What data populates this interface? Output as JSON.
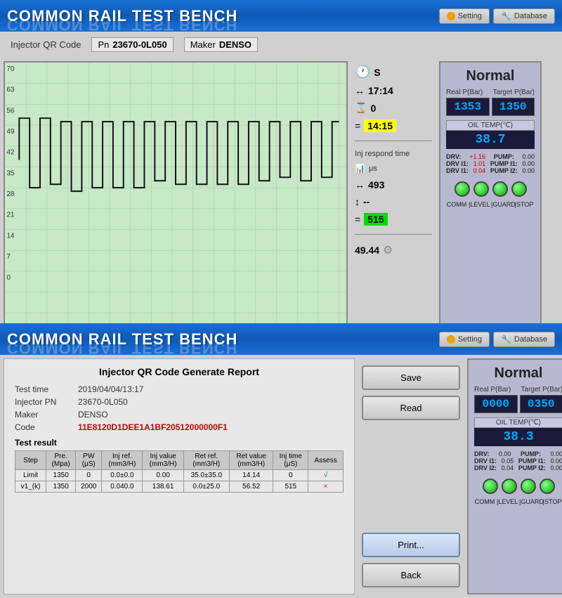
{
  "app": {
    "title": "COMMON RAIL TEST BENCH",
    "header_buttons": [
      {
        "label": "Setting",
        "icon": "gear"
      },
      {
        "label": "Database",
        "icon": "db"
      }
    ]
  },
  "top_section": {
    "injector": {
      "label": "Injector QR Code",
      "pn_label": "Pn",
      "pn_value": "23670-0L050",
      "maker_label": "Maker",
      "maker_value": "DENSO"
    },
    "info_panel": {
      "unit_s": "S",
      "time1": "17:14",
      "time2": "0",
      "time3_yellow": "14:15",
      "inj_respond_label": "Inj respond time",
      "unit_us": "μs",
      "val1": "493",
      "val2": "--",
      "val3_green": "515",
      "val4": "49.44"
    },
    "status": {
      "normal": "Normal",
      "real_p_label": "Real P(Bar)",
      "target_p_label": "Target P(Bar)",
      "real_p_value": "1353",
      "target_p_value": "1350",
      "oil_temp_label": "OIL TEMP(℃)",
      "oil_temp_value": "38.7",
      "drv": "+1.16",
      "drv1": "1.01",
      "drv2": "0.04",
      "pump": "0.00",
      "pump1": "0.00",
      "pump2": "0.00",
      "indicators": [
        "COMM",
        "LEVEL",
        "GUARD",
        "STOP"
      ]
    }
  },
  "bottom_section": {
    "report": {
      "title": "Injector QR Code Generate Report",
      "fields": [
        {
          "label": "Test time",
          "value": "2019/04/04/13:17",
          "color": "normal"
        },
        {
          "label": "Injector PN",
          "value": "23670-0L050",
          "color": "normal"
        },
        {
          "label": "Maker",
          "value": "DENSO",
          "color": "normal"
        },
        {
          "label": "Code",
          "value": "11E8120D1DEE1A1BF20512000000F1",
          "color": "red"
        }
      ],
      "result_label": "Test result",
      "table": {
        "headers": [
          "Step",
          "Pre. (Mpa)",
          "PW (μS)",
          "Inj ref. (mm3/H)",
          "Inj value (mm3/H)",
          "Ret ref. (mm3/H)",
          "Ret value (mm3/H)",
          "Inj time (μS)",
          "Assess"
        ],
        "rows": [
          [
            "Limit",
            "1350",
            "0",
            "0.0±0.0",
            "0.00",
            "35.0±35.0",
            "14.14",
            "0",
            "√"
          ],
          [
            "v1_(k)",
            "1350",
            "2000",
            "0.040.0",
            "138.61",
            "0.0±25.0",
            "56.52",
            "515",
            "×"
          ]
        ]
      }
    },
    "buttons": {
      "save": "Save",
      "read": "Read",
      "print": "Print...",
      "back": "Back"
    },
    "status": {
      "normal": "Normal",
      "real_p_label": "Real P(Bar)",
      "target_p_label": "Target P(Bar)",
      "real_p_value": "0000",
      "target_p_value": "0350",
      "oil_temp_label": "OIL TEMP(℃)",
      "oil_temp_value": "38.3",
      "drv": "0.00",
      "drv1": "0.05",
      "drv2": "0.04",
      "pump": "0.00",
      "pump1": "0.00",
      "pump2": "0.00",
      "indicators": [
        "COMM",
        "LEVEL",
        "GUARD",
        "STOP"
      ]
    }
  }
}
